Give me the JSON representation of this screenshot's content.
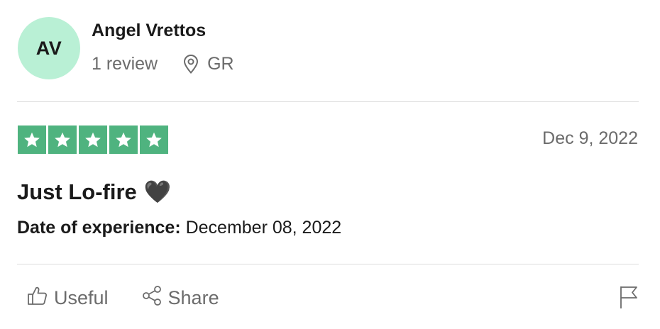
{
  "reviewer": {
    "initials": "AV",
    "name": "Angel Vrettos",
    "review_count": "1 review",
    "country": "GR",
    "avatar_color": "#b9f0d5"
  },
  "review": {
    "rating": 5,
    "rating_max": 5,
    "star_color": "#4fb37f",
    "date": "Dec 9, 2022",
    "title": "Just Lo-fire",
    "title_emoji": "🖤",
    "experience_label": "Date of experience:",
    "experience_date": "December 08, 2022"
  },
  "actions": {
    "useful_label": "Useful",
    "share_label": "Share"
  },
  "icons": {
    "location": "location-pin-icon",
    "useful": "thumbs-up-icon",
    "share": "share-icon",
    "report": "flag-icon",
    "star": "star-icon"
  }
}
